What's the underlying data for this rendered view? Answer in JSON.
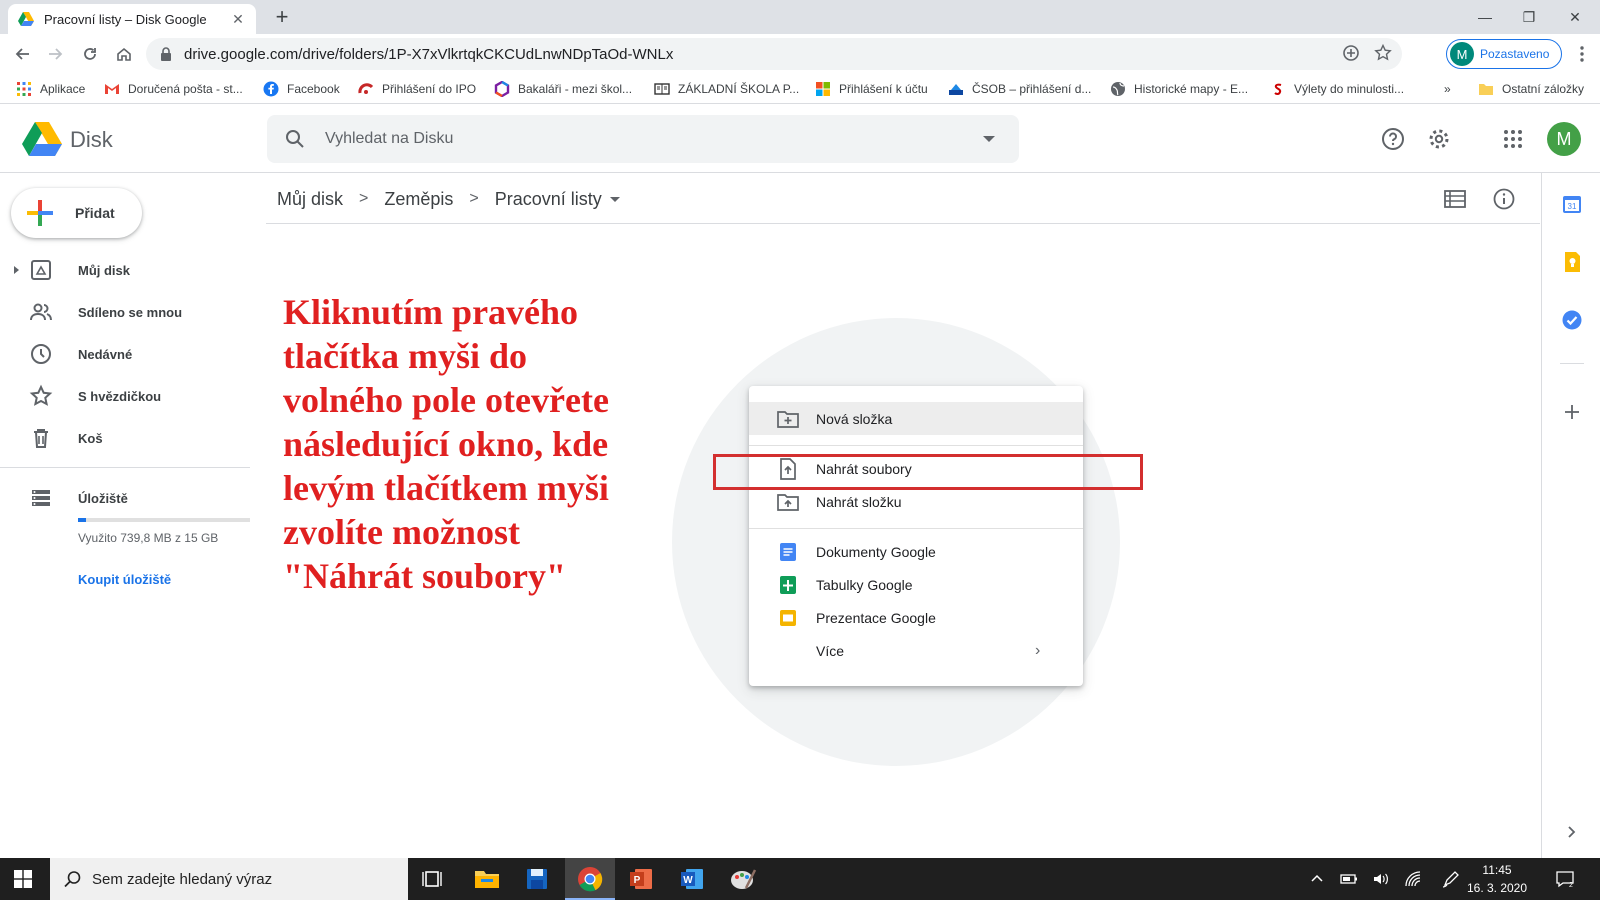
{
  "browser": {
    "tab_title": "Pracovní listy – Disk Google",
    "url": "drive.google.com/drive/folders/1P-X7xVlkrtqkCKCUdLnwNDpTaOd-WNLx",
    "profile_label": "Pozastaveno",
    "profile_initial": "M"
  },
  "bookmarks": {
    "items": [
      {
        "label": "Aplikace",
        "icon": "apps-grid-icon"
      },
      {
        "label": "Doručená pošta - st...",
        "icon": "gmail-icon"
      },
      {
        "label": "Facebook",
        "icon": "facebook-icon"
      },
      {
        "label": "Přihlášení do IPO",
        "icon": "ipo-icon"
      },
      {
        "label": "Bakaláři - mezi škol...",
        "icon": "bakalari-icon"
      },
      {
        "label": "ZÁKLADNÍ ŠKOLA P...",
        "icon": "book-icon"
      },
      {
        "label": "Přihlášení k účtu",
        "icon": "microsoft-icon"
      },
      {
        "label": "ČSOB – přihlášení d...",
        "icon": "csob-icon"
      },
      {
        "label": "Historické mapy - E...",
        "icon": "globe-icon"
      },
      {
        "label": "Výlety do minulosti...",
        "icon": "seznam-icon"
      }
    ],
    "more": "»",
    "other": "Ostatní záložky"
  },
  "drive": {
    "logo_text": "Disk",
    "search_placeholder": "Vyhledat na Disku",
    "avatar_initial": "M"
  },
  "sidebar": {
    "new_label": "Přidat",
    "items": [
      {
        "label": "Můj disk",
        "icon": "my-drive-icon"
      },
      {
        "label": "Sdíleno se mnou",
        "icon": "shared-people-icon"
      },
      {
        "label": "Nedávné",
        "icon": "clock-icon"
      },
      {
        "label": "S hvězdičkou",
        "icon": "star-icon"
      },
      {
        "label": "Koš",
        "icon": "trash-icon"
      }
    ],
    "storage_label": "Úložiště",
    "storage_used": "Využito 739,8 MB z 15 GB",
    "storage_fraction": 0.048,
    "buy_label": "Koupit úložiště"
  },
  "breadcrumb": {
    "items": [
      "Můj disk",
      "Zeměpis",
      "Pracovní listy"
    ],
    "separator": ">"
  },
  "instruction_text": "Kliknutím pravého tlačítka myši do volného pole otevřete následující okno, kde levým tlačítkem myši zvolíte možnost \"Náhrát soubory\"",
  "context_menu": {
    "new_folder": "Nová složka",
    "upload_files": "Nahrát soubory",
    "upload_folder": "Nahrát složku",
    "docs": "Dokumenty Google",
    "sheets": "Tabulky Google",
    "slides": "Prezentace Google",
    "more": "Více",
    "more_chevron": "›"
  },
  "taskbar": {
    "search_placeholder": "Sem zadejte hledaný výraz",
    "time": "11:45",
    "date": "16. 3. 2020"
  },
  "colors": {
    "accent": "#1a73e8",
    "annotation_red": "#e02020",
    "highlight_box": "#d32f2f"
  }
}
